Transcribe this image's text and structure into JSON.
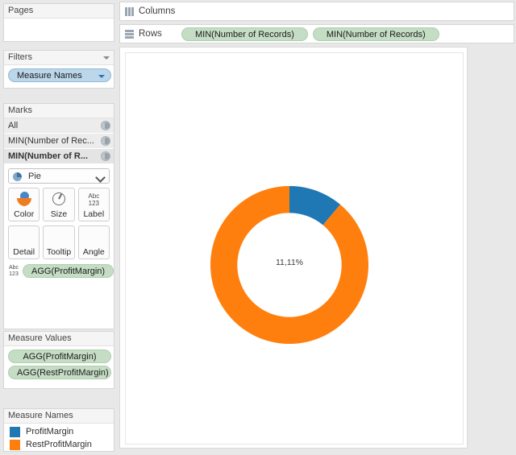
{
  "pages": {
    "title": "Pages"
  },
  "filters": {
    "title": "Filters",
    "pills": [
      {
        "label": "Measure Names"
      }
    ]
  },
  "marks": {
    "title": "Marks",
    "rows": [
      {
        "label": "All"
      },
      {
        "label": "MIN(Number of Rec..."
      },
      {
        "label": "MIN(Number of R..."
      }
    ],
    "mark_type": "Pie",
    "buttons": [
      {
        "label": "Color",
        "icon": "color-icon"
      },
      {
        "label": "Size",
        "icon": "size-icon"
      },
      {
        "label": "Label",
        "icon": "abc123-icon"
      },
      {
        "label": "Detail",
        "icon": "detail-icon"
      },
      {
        "label": "Tooltip",
        "icon": "tooltip-icon"
      },
      {
        "label": "Angle",
        "icon": "angle-icon"
      }
    ],
    "label_icon_top": "Abc",
    "label_icon_bottom": "123",
    "shelf_pill": "AGG(ProfitMargin)"
  },
  "measure_values": {
    "title": "Measure Values",
    "pills": [
      {
        "label": "AGG(ProfitMargin)"
      },
      {
        "label": "AGG(RestProfitMargin)"
      }
    ]
  },
  "measure_names": {
    "title": "Measure Names",
    "items": [
      {
        "label": "ProfitMargin",
        "color": "#1f77b4"
      },
      {
        "label": "RestProfitMargin",
        "color": "#ff7f0e"
      }
    ]
  },
  "shelves": {
    "columns": {
      "label": "Columns",
      "pills": []
    },
    "rows": {
      "label": "Rows",
      "pills": [
        {
          "label": "MIN(Number of Records)"
        },
        {
          "label": "MIN(Number of Records)"
        }
      ]
    }
  },
  "chart_data": {
    "type": "pie",
    "variant": "donut",
    "title": "",
    "labels": [
      "ProfitMargin",
      "RestProfitMargin"
    ],
    "values": [
      11.11,
      88.89
    ],
    "colors": [
      "#1f77b4",
      "#ff7f0e"
    ],
    "annotation": "11,11%",
    "start_angle_deg": 0,
    "inner_radius_ratio": 0.66,
    "legend_position": "left",
    "grid": false
  }
}
